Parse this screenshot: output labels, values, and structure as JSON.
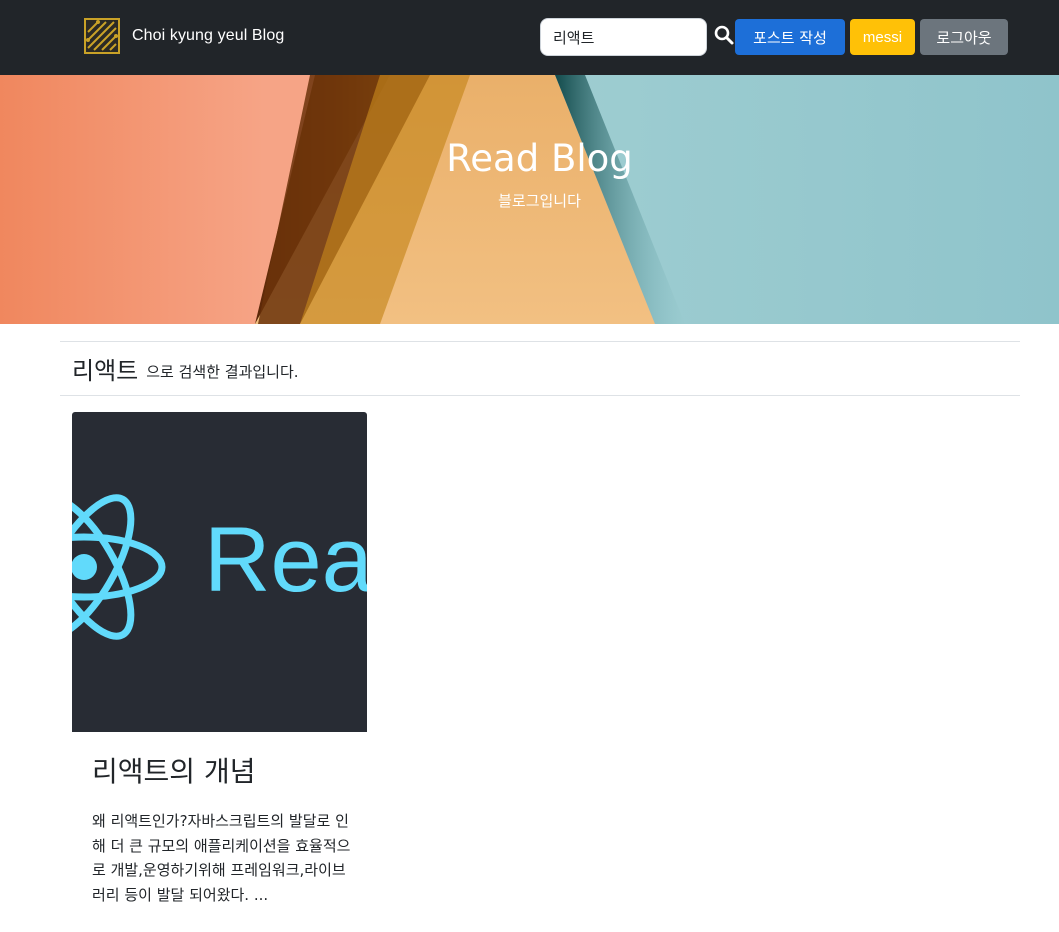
{
  "navbar": {
    "brand_text": "Choi kyung yeul Blog",
    "search_value": "리액트",
    "write_button": "포스트 작성",
    "user_button": "messi",
    "logout_button": "로그아웃"
  },
  "hero": {
    "title": "Read Blog",
    "subtitle": "블로그입니다"
  },
  "results": {
    "keyword": "리액트",
    "suffix": "으로 검색한 결과입니다."
  },
  "posts": [
    {
      "title": "리액트의 개념",
      "image_text": "Reac",
      "excerpt": "왜 리액트인가?자바스크립트의 발달로 인해 더 큰 규모의 애플리케이션을 효율적으로 개발,운영하기위해 프레임워크,라이브러리 등이 발달 되어왔다. ..."
    }
  ],
  "colors": {
    "navbar_bg": "#212529",
    "primary": "#1d6fd8",
    "warning": "#ffc107",
    "secondary": "#6c757d",
    "react_cyan": "#61dafb",
    "card_dark": "#282c34"
  },
  "icons": {
    "brand": "circuit-logo-icon",
    "search": "search-icon",
    "react": "react-atom-icon"
  }
}
